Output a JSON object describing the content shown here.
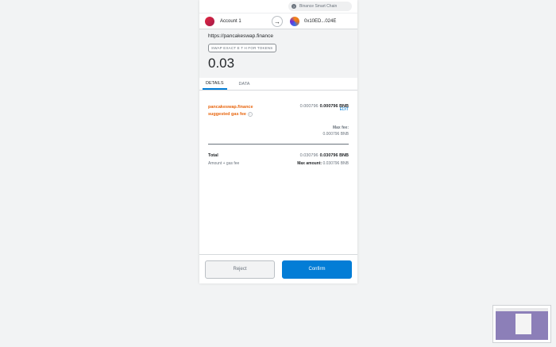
{
  "network": {
    "label": "Binance Smart Chain",
    "icon": "?"
  },
  "accounts": {
    "from_name": "Account 1",
    "to_address": "0x10ED...024E",
    "arrow_icon": "→"
  },
  "summary": {
    "origin": "https://pancakeswap.finance",
    "method": "SWAP EXACT E T H FOR TOKENS",
    "amount": "0.03"
  },
  "tabs": [
    {
      "label": "DETAILS",
      "active": true
    },
    {
      "label": "DATA",
      "active": false
    }
  ],
  "details": {
    "edit_label": "EDIT",
    "gas_label_line1": "pancakeswap.finance",
    "gas_label_line2": "suggested gas fee",
    "info_icon": "i",
    "gas_value_light": "0.000796",
    "gas_value_bold": "0.000796 BNB",
    "max_fee_label": "Max fee:",
    "max_fee_value": "0.000796 BNB",
    "total_label": "Total",
    "total_value_light": "0.030796",
    "total_value_bold": "0.030796 BNB",
    "total_sub": "Amount + gas fee",
    "max_amount_label": "Max amount:",
    "max_amount_value": "0.030796 BNB"
  },
  "footer": {
    "reject_label": "Reject",
    "confirm_label": "Confirm"
  },
  "colors": {
    "accent": "#037dd6",
    "warning": "#e8650d",
    "background": "#f2f3f4"
  }
}
